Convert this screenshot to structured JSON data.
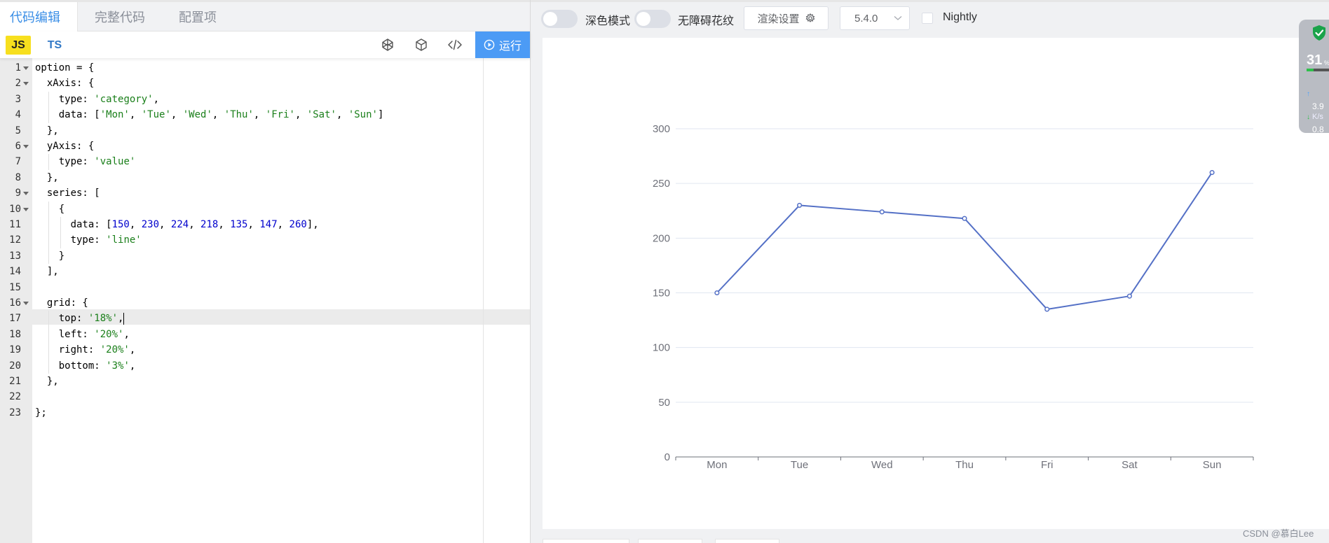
{
  "editor_tabs": [
    {
      "label": "代码编辑",
      "active": true
    },
    {
      "label": "完整代码",
      "active": false
    },
    {
      "label": "配置项",
      "active": false
    }
  ],
  "language_tabs": {
    "js": "JS",
    "ts": "TS"
  },
  "toolbar_icons": [
    "codepen-icon",
    "codesandbox-icon",
    "code-icon"
  ],
  "run_button": {
    "label": "运行",
    "icon": "play-circle-icon"
  },
  "editor": {
    "active_line": 17,
    "lines": [
      {
        "n": "1",
        "fold": true,
        "tokens": [
          [
            "t",
            "option = {"
          ]
        ]
      },
      {
        "n": "2",
        "fold": true,
        "tokens": [
          [
            "t",
            "  xAxis: {"
          ]
        ]
      },
      {
        "n": "3",
        "fold": false,
        "tokens": [
          [
            "t",
            "    type: "
          ],
          [
            "s",
            "'category'"
          ],
          [
            "t",
            ","
          ]
        ]
      },
      {
        "n": "4",
        "fold": false,
        "tokens": [
          [
            "t",
            "    data: ["
          ],
          [
            "s",
            "'Mon'"
          ],
          [
            "t",
            ", "
          ],
          [
            "s",
            "'Tue'"
          ],
          [
            "t",
            ", "
          ],
          [
            "s",
            "'Wed'"
          ],
          [
            "t",
            ", "
          ],
          [
            "s",
            "'Thu'"
          ],
          [
            "t",
            ", "
          ],
          [
            "s",
            "'Fri'"
          ],
          [
            "t",
            ", "
          ],
          [
            "s",
            "'Sat'"
          ],
          [
            "t",
            ", "
          ],
          [
            "s",
            "'Sun'"
          ],
          [
            "t",
            "]"
          ]
        ]
      },
      {
        "n": "5",
        "fold": false,
        "tokens": [
          [
            "t",
            "  },"
          ]
        ]
      },
      {
        "n": "6",
        "fold": true,
        "tokens": [
          [
            "t",
            "  yAxis: {"
          ]
        ]
      },
      {
        "n": "7",
        "fold": false,
        "tokens": [
          [
            "t",
            "    type: "
          ],
          [
            "s",
            "'value'"
          ]
        ]
      },
      {
        "n": "8",
        "fold": false,
        "tokens": [
          [
            "t",
            "  },"
          ]
        ]
      },
      {
        "n": "9",
        "fold": true,
        "tokens": [
          [
            "t",
            "  series: ["
          ]
        ]
      },
      {
        "n": "10",
        "fold": true,
        "tokens": [
          [
            "t",
            "    {"
          ]
        ]
      },
      {
        "n": "11",
        "fold": false,
        "tokens": [
          [
            "t",
            "      data: ["
          ],
          [
            "n",
            "150"
          ],
          [
            "t",
            ", "
          ],
          [
            "n",
            "230"
          ],
          [
            "t",
            ", "
          ],
          [
            "n",
            "224"
          ],
          [
            "t",
            ", "
          ],
          [
            "n",
            "218"
          ],
          [
            "t",
            ", "
          ],
          [
            "n",
            "135"
          ],
          [
            "t",
            ", "
          ],
          [
            "n",
            "147"
          ],
          [
            "t",
            ", "
          ],
          [
            "n",
            "260"
          ],
          [
            "t",
            "],"
          ]
        ]
      },
      {
        "n": "12",
        "fold": false,
        "tokens": [
          [
            "t",
            "      type: "
          ],
          [
            "s",
            "'line'"
          ]
        ]
      },
      {
        "n": "13",
        "fold": false,
        "tokens": [
          [
            "t",
            "    }"
          ]
        ]
      },
      {
        "n": "14",
        "fold": false,
        "tokens": [
          [
            "t",
            "  ],"
          ]
        ]
      },
      {
        "n": "15",
        "fold": false,
        "tokens": []
      },
      {
        "n": "16",
        "fold": true,
        "tokens": [
          [
            "t",
            "  grid: {"
          ]
        ]
      },
      {
        "n": "17",
        "fold": false,
        "tokens": [
          [
            "t",
            "    top: "
          ],
          [
            "s",
            "'18%'"
          ],
          [
            "t",
            ","
          ],
          [
            "c",
            ""
          ]
        ]
      },
      {
        "n": "18",
        "fold": false,
        "tokens": [
          [
            "t",
            "    left: "
          ],
          [
            "s",
            "'20%'"
          ],
          [
            "t",
            ","
          ]
        ]
      },
      {
        "n": "19",
        "fold": false,
        "tokens": [
          [
            "t",
            "    right: "
          ],
          [
            "s",
            "'20%'"
          ],
          [
            "t",
            ","
          ]
        ]
      },
      {
        "n": "20",
        "fold": false,
        "tokens": [
          [
            "t",
            "    bottom: "
          ],
          [
            "s",
            "'3%'"
          ],
          [
            "t",
            ","
          ]
        ]
      },
      {
        "n": "21",
        "fold": false,
        "tokens": [
          [
            "t",
            "  },"
          ]
        ]
      },
      {
        "n": "22",
        "fold": false,
        "tokens": []
      },
      {
        "n": "23",
        "fold": false,
        "tokens": [
          [
            "t",
            "};"
          ]
        ]
      }
    ]
  },
  "preview_toolbar": {
    "dark_mode_label": "深色模式",
    "dark_mode_on": false,
    "accessible_label": "无障碍花纹",
    "accessible_on": false,
    "render_settings_label": "渲染设置",
    "version": "5.4.0",
    "nightly_label": "Nightly",
    "nightly_checked": false
  },
  "chart_data": {
    "type": "line",
    "categories": [
      "Mon",
      "Tue",
      "Wed",
      "Thu",
      "Fri",
      "Sat",
      "Sun"
    ],
    "series": [
      {
        "values": [
          150,
          230,
          224,
          218,
          135,
          147,
          260
        ]
      }
    ],
    "y_ticks": [
      "0",
      "50",
      "100",
      "150",
      "200",
      "250",
      "300"
    ],
    "ylim": [
      0,
      300
    ],
    "grid": true,
    "line_color": "#5470c6"
  },
  "floating_widget": {
    "percent": "31",
    "percent_fraction": "%",
    "usage_fraction": 0.31,
    "upload": "3.9",
    "upload_unit": "K/s",
    "download": "0.8",
    "download_unit": "K/s"
  },
  "watermark": "CSDN @慕白Lee",
  "colors": {
    "accent": "#3a8ee6",
    "run_button": "#4c9bf5",
    "string": "#1a7f1a",
    "number": "#0000cd"
  }
}
